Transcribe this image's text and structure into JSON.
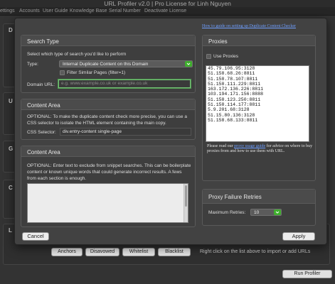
{
  "window": {
    "title": "URL Profiler v2.0 | Pro License for Linh Nguyen"
  },
  "menubar": {
    "items": [
      "ettings",
      "Accounts",
      "User Guide",
      "Knowledge Base",
      "Serial Number",
      "Deactivate License"
    ]
  },
  "background": {
    "panel_letters": [
      "D",
      "U",
      "G",
      "C",
      "L"
    ],
    "list_buttons": [
      "Anchors",
      "Disavowed",
      "Whitelist",
      "Blacklist"
    ],
    "proxies_hint": "Right click on the list above to import or add URLs",
    "run_button": "Run Profiler"
  },
  "dialog": {
    "help_link": "How to guide on setting up Duplicate Content Checker",
    "search_type": {
      "title": "Search Type",
      "instruction": "Select which type of search you'd like to perform",
      "type_label": "Type:",
      "type_value": "Internal Duplicate Content on this Domain",
      "filter_label": "Filter Similar Pages (filter=1)",
      "domain_label": "Domain URL:",
      "domain_placeholder": "e.g. www.example.co.uk or example.co.uk"
    },
    "content_area": {
      "title": "Content Area",
      "description": "OPTIONAL: To make the duplicate content check more precise, you can use a CSS selector to isolate the HTML element containing the main copy.",
      "selector_label": "CSS Selector:",
      "selector_value": "div.entry-content single-page"
    },
    "content_area2": {
      "title": "Content Area",
      "description": "OPTIONAL: Enter text to exclude from snippet searches. This can be boilerplate content or known unique words that could generate incorrect results. A fews from each section is enough."
    },
    "proxies": {
      "title": "Proxies",
      "use_label": "Use Proxies",
      "list": [
        "45.79.106.95:3128",
        "51.158.68.26:8811",
        "51.158.78.107:8811",
        "51.158.111.229:8811",
        "163.172.136.226:8811",
        "103.194.171.156:8888",
        "51.158.123.250:8811",
        "51.158.114.177:8811",
        "5.9.201.68:3128",
        "51.15.80.136:3128",
        "51.158.68.133:8811"
      ],
      "note_before": "Please read our ",
      "note_link": "proxy usage guide",
      "note_after": " for advice on where to buy proxies from and how to use them with URL."
    },
    "retries": {
      "title": "Proxy Failure Retries",
      "label": "Maximum Retries:",
      "value": "10"
    },
    "cancel_button": "Cancel",
    "apply_button": "Apply"
  }
}
